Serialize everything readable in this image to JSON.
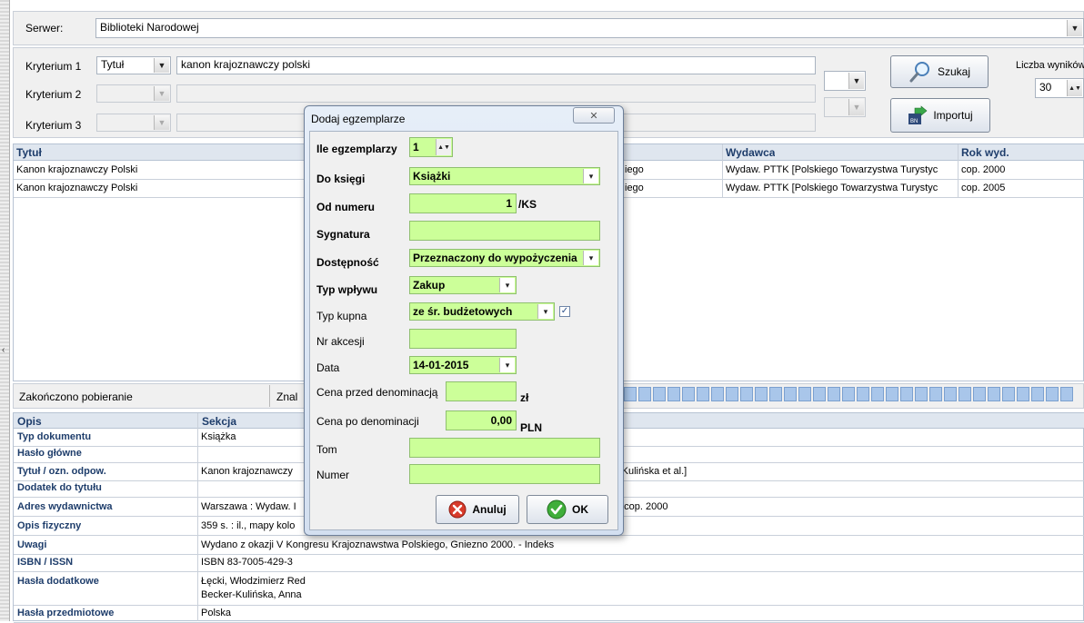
{
  "server": {
    "label": "Serwer:",
    "value": "Biblioteki Narodowej"
  },
  "criteria": [
    {
      "label": "Kryterium 1",
      "field": "Tytuł",
      "value": "kanon krajoznawczy polski"
    },
    {
      "label": "Kryterium 2",
      "field": "",
      "value": ""
    },
    {
      "label": "Kryterium 3",
      "field": "",
      "value": ""
    }
  ],
  "search_button": "Szukaj",
  "import_button": "Importuj",
  "results_count": {
    "label": "Liczba wyników",
    "value": "30"
  },
  "results": {
    "columns": {
      "title": "Tytuł",
      "publisher": "Wydawca",
      "year": "Rok wyd."
    },
    "rows": [
      {
        "title": "Kanon krajoznawczy Polski",
        "author_tail": "iego",
        "publisher": "Wydaw. PTTK [Polskiego Towarzystwa Turystyc",
        "year": "cop. 2000"
      },
      {
        "title": "Kanon krajoznawczy Polski",
        "author_tail": "iego",
        "publisher": "Wydaw. PTTK [Polskiego Towarzystwa Turystyc",
        "year": "cop. 2005"
      }
    ]
  },
  "status": {
    "text": "Zakończono pobieranie",
    "found": "Znal"
  },
  "details": {
    "columns": {
      "desc": "Opis",
      "section": "Sekcja"
    },
    "rows": [
      {
        "label": "Typ dokumentu",
        "value": "Książka"
      },
      {
        "label": "Hasło główne",
        "value": ""
      },
      {
        "label": "Tytuł / ozn. odpow.",
        "value": "Kanon krajoznawczy",
        "tail": "-Kulińska et al.]"
      },
      {
        "label": "Dodatek do tytułu",
        "value": ""
      },
      {
        "label": "Adres wydawnictwa",
        "value": "Warszawa : Wydaw. I",
        "tail": ", cop. 2000"
      },
      {
        "label": "Opis fizyczny",
        "value": "359 s. : il., mapy kolo"
      },
      {
        "label": "Uwagi",
        "value": "Wydano z okazji V Kongresu Krajoznawstwa Polskiego, Gniezno 2000. - Indeks"
      },
      {
        "label": "ISBN / ISSN",
        "value": "ISBN 83-7005-429-3"
      },
      {
        "label": "Hasła dodatkowe",
        "value": "Łęcki, Włodzimierz Red",
        "value2": "Becker-Kulińska, Anna"
      },
      {
        "label": "Hasła przedmiotowe",
        "value": "Polska"
      }
    ]
  },
  "dialog": {
    "title": "Dodaj egzemplarze",
    "copies": {
      "label": "Ile egzemplarzy",
      "value": "1"
    },
    "book": {
      "label": "Do księgi",
      "value": "Książki"
    },
    "from_number": {
      "label": "Od numeru",
      "value": "1",
      "suffix": "/KS"
    },
    "signature": {
      "label": "Sygnatura",
      "value": ""
    },
    "availability": {
      "label": "Dostępność",
      "value": "Przeznaczony do wypożyczenia"
    },
    "inflow": {
      "label": "Typ wpływu",
      "value": "Zakup"
    },
    "purchase": {
      "label": "Typ kupna",
      "value": "ze śr. budżetowych"
    },
    "accession": {
      "label": "Nr akcesji",
      "value": ""
    },
    "date": {
      "label": "Data",
      "value": "14-01-2015"
    },
    "price_before": {
      "label": "Cena przed denominacją",
      "value": "",
      "unit": "zł"
    },
    "price_after": {
      "label": "Cena po denominacji",
      "value": "0,00",
      "unit": "PLN"
    },
    "volume": {
      "label": "Tom",
      "value": ""
    },
    "number": {
      "label": "Numer",
      "value": ""
    },
    "cancel": "Anuluj",
    "ok": "OK"
  }
}
